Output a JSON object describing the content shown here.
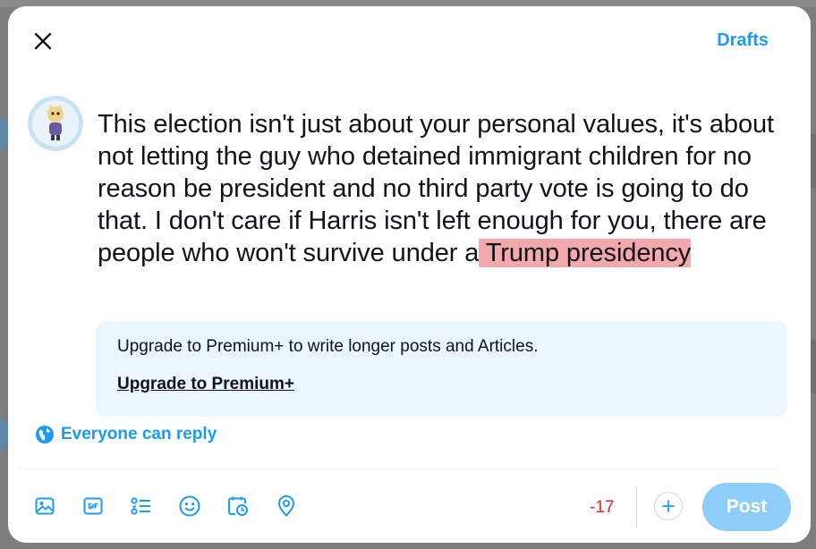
{
  "header": {
    "drafts_label": "Drafts"
  },
  "compose": {
    "text_within_limit": "This election isn't just about your personal values, it's about not letting the guy who detained immigrant children for no reason be president and no third party vote is going to do that. I don't care if Harris isn't left enough for you, there are people who won't survive under a",
    "text_over_limit": " Trump presidency"
  },
  "upsell": {
    "message": "Upgrade to Premium+ to write longer posts and Articles.",
    "link_label": "Upgrade to Premium+"
  },
  "reply_setting": {
    "label": "Everyone can reply"
  },
  "toolbar": {
    "icons": [
      "image-icon",
      "gif-icon",
      "poll-icon",
      "emoji-icon",
      "schedule-icon",
      "location-icon"
    ],
    "char_counter": "-17",
    "post_label": "Post"
  },
  "colors": {
    "accent": "#1d9bf0",
    "over_limit_highlight": "#f3a8ad",
    "counter_negative": "#f4212e",
    "post_disabled": "#8ecdf7",
    "upsell_background": "#eaf5fd"
  }
}
